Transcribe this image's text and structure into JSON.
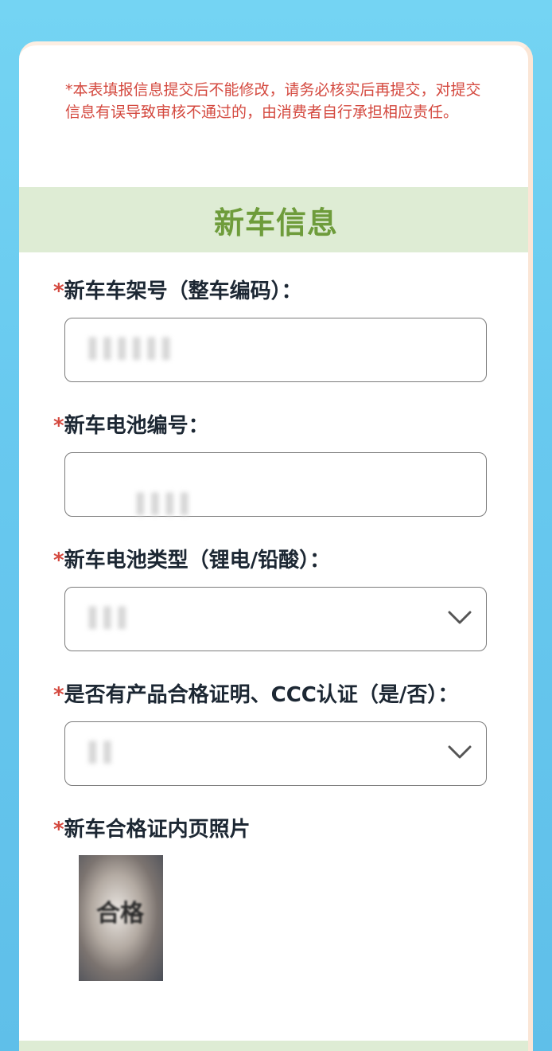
{
  "notice": "*本表填报信息提交后不能修改，请务必核实后再提交，对提交信息有误导致审核不通过的，由消费者自行承担相应责任。",
  "section": {
    "title": "新车信息"
  },
  "fields": [
    {
      "required_mark": "*",
      "label": "新车车架号（整车编码）：",
      "type": "text",
      "value": "▌▌▌▌▌▌"
    },
    {
      "required_mark": "*",
      "label": "新车电池编号：",
      "type": "text",
      "value": "▌▌▌▌"
    },
    {
      "required_mark": "*",
      "label": "新车电池类型（锂电/铅酸）：",
      "type": "select",
      "value": "▌▌▌"
    },
    {
      "required_mark": "*",
      "label": "是否有产品合格证明、CCC认证（是/否）：",
      "type": "select",
      "value": "▌▌"
    }
  ],
  "photo_field": {
    "required_mark": "*",
    "label": "新车合格证内页照片",
    "photo_text": "合格"
  },
  "icons": {
    "select_arrow": "chevron-down-icon"
  },
  "colors": {
    "required": "#d4493f",
    "section_title": "#6e9c3b",
    "section_bg": "#deecd4",
    "background": "#68c9ef"
  }
}
